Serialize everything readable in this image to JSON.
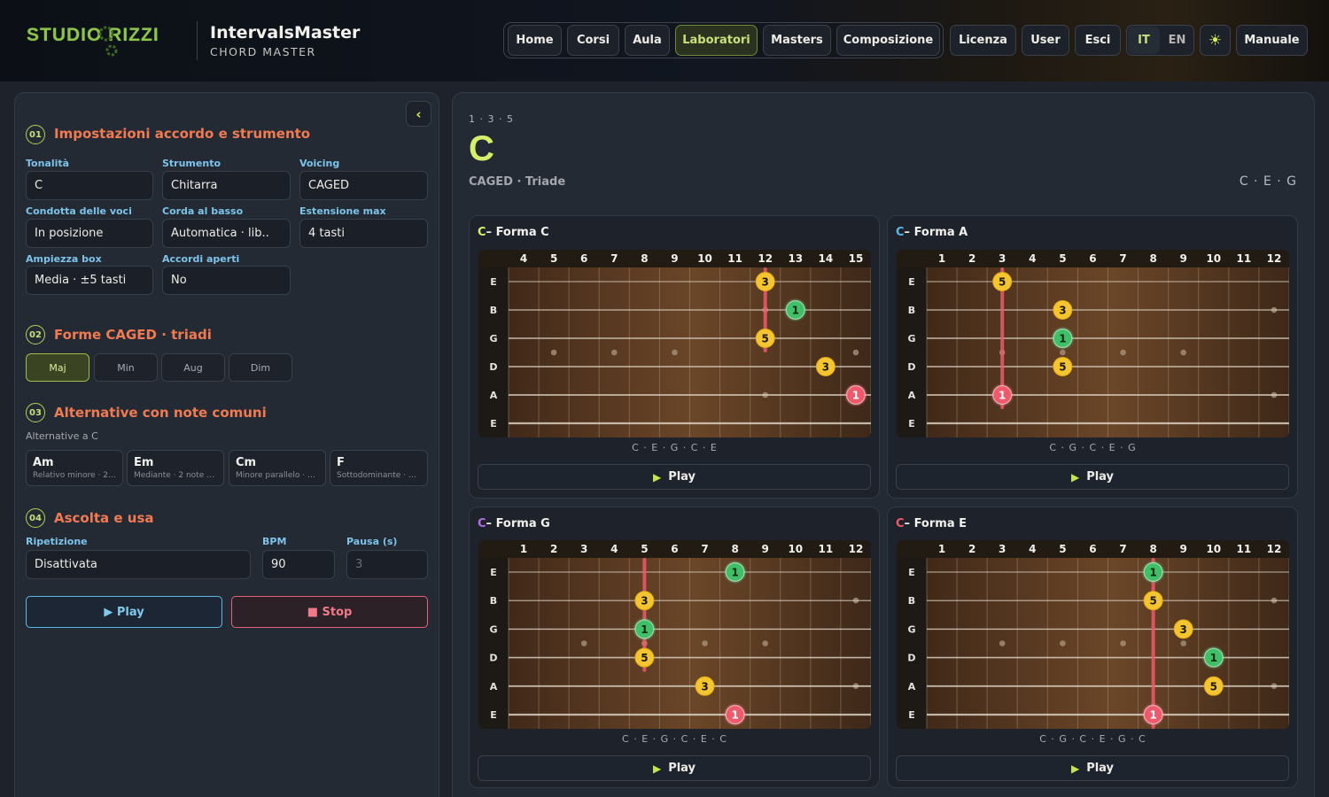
{
  "header": {
    "logo_text": "STUDIO RIZZI",
    "app_title": "IntervalsMaster",
    "app_subtitle": "CHORD MASTER",
    "nav": [
      "Home",
      "Corsi",
      "Aula",
      "Laboratori",
      "Masters",
      "Composizione"
    ],
    "nav_active": "Laboratori",
    "nav_right": [
      "Licenza",
      "User",
      "Esci"
    ],
    "lang_it": "IT",
    "lang_en": "EN",
    "lang_active": "IT",
    "theme_icon": "sun-icon",
    "manual": "Manuale"
  },
  "sidebar": {
    "collapse_icon": "chevron-left-icon",
    "section1": {
      "num": "01",
      "title": "Impostazioni accordo e strumento",
      "fields": [
        {
          "label": "Tonalità",
          "value": "C"
        },
        {
          "label": "Strumento",
          "value": "Chitarra"
        },
        {
          "label": "Voicing",
          "value": "CAGED"
        },
        {
          "label": "Condotta delle voci",
          "value": "In posizione"
        },
        {
          "label": "Corda al basso",
          "value": "Automatica · lib.."
        },
        {
          "label": "Estensione max",
          "value": "4 tasti"
        },
        {
          "label": "Ampiezza box",
          "value": "Media · ±5 tasti"
        },
        {
          "label": "Accordi aperti",
          "value": "No"
        }
      ]
    },
    "section2": {
      "num": "02",
      "title": "Forme CAGED · triadi",
      "toggles": [
        "Maj",
        "Min",
        "Aug",
        "Dim"
      ],
      "active": "Maj"
    },
    "section3": {
      "num": "03",
      "title": "Alternative con note comuni",
      "subtitle": "Alternative a C",
      "cards": [
        {
          "name": "Am",
          "desc": "Relativo minore · 2 n..."
        },
        {
          "name": "Em",
          "desc": "Mediante · 2 note c..."
        },
        {
          "name": "Cm",
          "desc": "Minore parallelo · 2 ..."
        },
        {
          "name": "F",
          "desc": "Sottodominante · 1 ..."
        }
      ]
    },
    "section4": {
      "num": "04",
      "title": "Ascolta e usa",
      "repeat_label": "Ripetizione",
      "repeat_value": "Disattivata",
      "bpm_label": "BPM",
      "bpm_value": "90",
      "pause_label": "Pausa (s)",
      "pause_value": "3",
      "play": "▶ Play",
      "stop": "■ Stop"
    }
  },
  "main": {
    "formula": "1 · 3 · 5",
    "chord": "C",
    "kind": "CAGED · Triade",
    "notes": "C · E · G",
    "colors": {
      "root": "#ee5a6c",
      "third": "#f5c431",
      "fifth": "#f5c431",
      "green": "#3fbf66",
      "accent": "#c9e07a"
    },
    "shapes": [
      {
        "root": "C",
        "form": "– Forma C",
        "root_color": "#d6ef6a",
        "frets": [
          4,
          5,
          6,
          7,
          8,
          9,
          10,
          11,
          12,
          13,
          14,
          15
        ],
        "dots": [
          5,
          7,
          9,
          15
        ],
        "double_dot": 12,
        "barre_fret": 12,
        "barre_from": 0,
        "barre_to": 2,
        "barre_color": "#ee5a6c",
        "notes": [
          {
            "string": 0,
            "fret": 12,
            "label": "3",
            "kind": "y"
          },
          {
            "string": 1,
            "fret": 13,
            "label": "1",
            "kind": "g"
          },
          {
            "string": 2,
            "fret": 12,
            "label": "5",
            "kind": "y"
          },
          {
            "string": 3,
            "fret": 14,
            "label": "3",
            "kind": "y"
          },
          {
            "string": 4,
            "fret": 15,
            "label": "1",
            "kind": "r"
          }
        ],
        "sequence": "C · E · G · C · E",
        "play": "Play"
      },
      {
        "root": "C",
        "form": "– Forma A",
        "root_color": "#5ab8e6",
        "frets": [
          1,
          2,
          3,
          4,
          5,
          6,
          7,
          8,
          9,
          10,
          11,
          12
        ],
        "dots": [
          3,
          5,
          7,
          9
        ],
        "double_dot": 12,
        "barre_fret": 3,
        "barre_from": 0,
        "barre_to": 4,
        "barre_color": "#ee5a6c",
        "notes": [
          {
            "string": 0,
            "fret": 3,
            "label": "5",
            "kind": "y"
          },
          {
            "string": 1,
            "fret": 5,
            "label": "3",
            "kind": "y"
          },
          {
            "string": 2,
            "fret": 5,
            "label": "1",
            "kind": "g"
          },
          {
            "string": 3,
            "fret": 5,
            "label": "5",
            "kind": "y"
          },
          {
            "string": 4,
            "fret": 3,
            "label": "1",
            "kind": "r"
          }
        ],
        "sequence": "C · G · C · E · G",
        "play": "Play"
      },
      {
        "root": "C",
        "form": "– Forma G",
        "root_color": "#b46de8",
        "frets": [
          1,
          2,
          3,
          4,
          5,
          6,
          7,
          8,
          9,
          10,
          11,
          12
        ],
        "dots": [
          3,
          5,
          7,
          9
        ],
        "double_dot": 12,
        "barre_fret": 5,
        "barre_from": 0,
        "barre_to": 3,
        "barre_color": "#ee5a6c",
        "notes": [
          {
            "string": 0,
            "fret": 8,
            "label": "1",
            "kind": "g"
          },
          {
            "string": 1,
            "fret": 5,
            "label": "3",
            "kind": "y"
          },
          {
            "string": 2,
            "fret": 5,
            "label": "1",
            "kind": "g"
          },
          {
            "string": 3,
            "fret": 5,
            "label": "5",
            "kind": "y"
          },
          {
            "string": 4,
            "fret": 7,
            "label": "3",
            "kind": "y"
          },
          {
            "string": 5,
            "fret": 8,
            "label": "1",
            "kind": "r"
          }
        ],
        "sequence": "C · E · G · C · E · C",
        "play": "Play"
      },
      {
        "root": "C",
        "form": "– Forma E",
        "root_color": "#ee5a6c",
        "frets": [
          1,
          2,
          3,
          4,
          5,
          6,
          7,
          8,
          9,
          10,
          11,
          12
        ],
        "dots": [
          3,
          5,
          7,
          9
        ],
        "double_dot": 12,
        "barre_fret": 8,
        "barre_from": 0,
        "barre_to": 5,
        "barre_color": "#ee5a6c",
        "notes": [
          {
            "string": 0,
            "fret": 8,
            "label": "1",
            "kind": "g"
          },
          {
            "string": 1,
            "fret": 8,
            "label": "5",
            "kind": "y"
          },
          {
            "string": 2,
            "fret": 9,
            "label": "3",
            "kind": "y"
          },
          {
            "string": 3,
            "fret": 10,
            "label": "1",
            "kind": "g"
          },
          {
            "string": 4,
            "fret": 10,
            "label": "5",
            "kind": "y"
          },
          {
            "string": 5,
            "fret": 8,
            "label": "1",
            "kind": "r"
          }
        ],
        "sequence": "C · G · C · E · G · C",
        "play": "Play"
      }
    ],
    "strings": [
      "E",
      "B",
      "G",
      "D",
      "A",
      "E"
    ]
  }
}
